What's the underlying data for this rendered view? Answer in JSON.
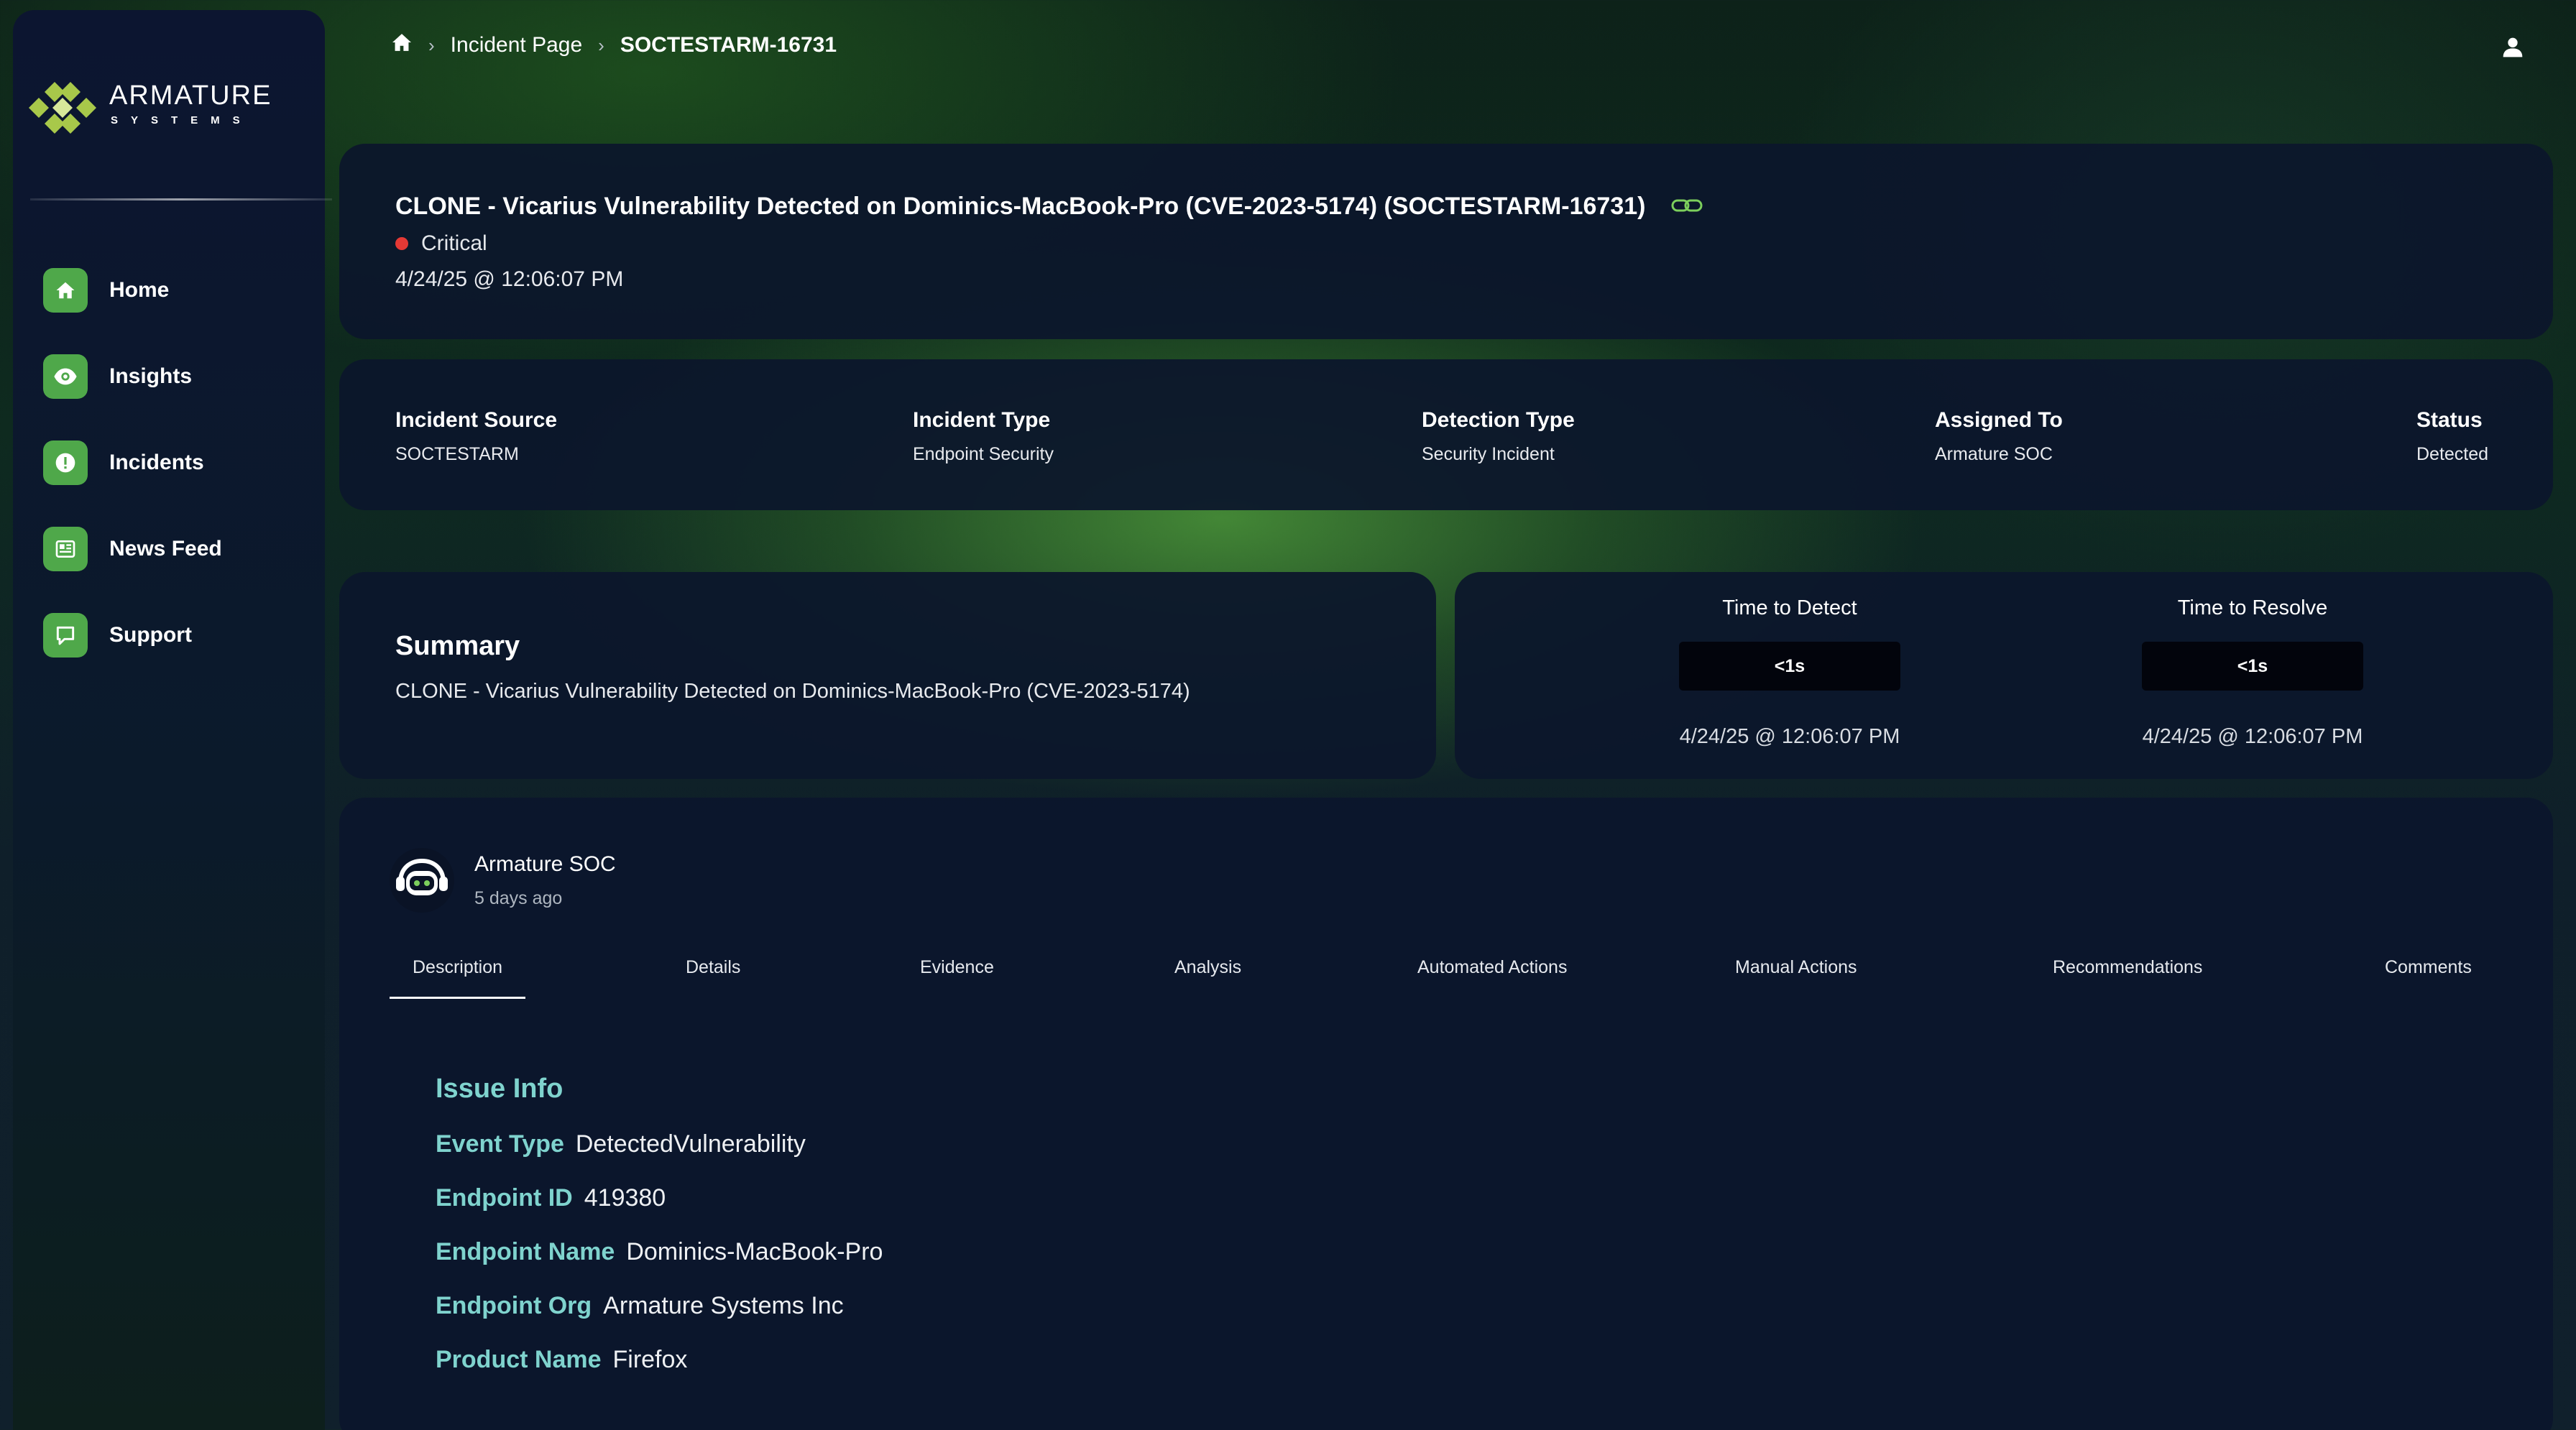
{
  "brand": {
    "name": "ARMATURE",
    "sub": "SYSTEMS"
  },
  "nav": [
    {
      "label": "Home",
      "icon": "home-icon"
    },
    {
      "label": "Insights",
      "icon": "eye-icon"
    },
    {
      "label": "Incidents",
      "icon": "alert-icon"
    },
    {
      "label": "News Feed",
      "icon": "newspaper-icon"
    },
    {
      "label": "Support",
      "icon": "chat-icon"
    }
  ],
  "breadcrumb": {
    "parent": "Incident Page",
    "current": "SOCTESTARM-16731"
  },
  "incident": {
    "title": "CLONE - Vicarius Vulnerability Detected on Dominics-MacBook-Pro (CVE-2023-5174) (SOCTESTARM-16731)",
    "severity": "Critical",
    "severity_color": "#e53935",
    "date": "4/24/25 @ 12:06:07 PM"
  },
  "meta": [
    {
      "label": "Incident Source",
      "value": "SOCTESTARM"
    },
    {
      "label": "Incident Type",
      "value": "Endpoint Security"
    },
    {
      "label": "Detection Type",
      "value": "Security Incident"
    },
    {
      "label": "Assigned To",
      "value": "Armature SOC"
    },
    {
      "label": "Status",
      "value": "Detected"
    }
  ],
  "summary": {
    "title": "Summary",
    "text": "CLONE - Vicarius Vulnerability Detected on Dominics-MacBook-Pro (CVE-2023-5174)"
  },
  "timing": [
    {
      "label": "Time to Detect",
      "value": "<1s",
      "date": "4/24/25 @ 12:06:07 PM"
    },
    {
      "label": "Time to Resolve",
      "value": "<1s",
      "date": "4/24/25 @ 12:06:07 PM"
    }
  ],
  "author": {
    "name": "Armature SOC",
    "time": "5 days ago"
  },
  "tabs": [
    "Description",
    "Details",
    "Evidence",
    "Analysis",
    "Automated Actions",
    "Manual Actions",
    "Recommendations",
    "Comments"
  ],
  "active_tab": "Description",
  "issue": {
    "title": "Issue Info",
    "rows": [
      {
        "key": "Event Type",
        "value": "DetectedVulnerability"
      },
      {
        "key": "Endpoint ID",
        "value": "419380"
      },
      {
        "key": "Endpoint Name",
        "value": "Dominics-MacBook-Pro"
      },
      {
        "key": "Endpoint Org",
        "value": "Armature Systems Inc"
      },
      {
        "key": "Product Name",
        "value": "Firefox"
      }
    ]
  },
  "colors": {
    "accent": "#4fa84a",
    "teal": "#7fd3ce",
    "card": "#0c162c"
  }
}
